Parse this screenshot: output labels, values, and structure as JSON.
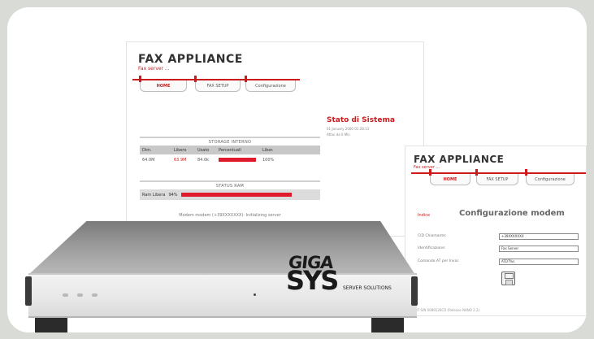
{
  "shot1": {
    "app_title": "FAX APPLIANCE",
    "app_subtitle": "Fax server ...",
    "tabs": [
      "HOME",
      "FAX SETUP",
      "Configurazione"
    ],
    "storage": {
      "heading": "STORAGE INTERNO",
      "columns": [
        "Dim.",
        "Libero",
        "Usato",
        "Percentuali",
        "Liber."
      ],
      "values": {
        "dim": "64.0M",
        "libero": "63.9M",
        "usato": "84.0k",
        "libero_pct": "100%"
      },
      "bar_fill": 0.99
    },
    "ram": {
      "heading": "STATUS RAM",
      "label": "Ram Libera",
      "pct": "94%",
      "bar_fill": 0.94
    },
    "modem_status": "Modem modem (+39XXXXXXX): Initializing server",
    "system": {
      "title": "Stato di Sistema",
      "date": "01 January 2000 01:28:13",
      "uptime": "Attivi da 0 Min"
    }
  },
  "shot2": {
    "app_title": "FAX APPLIANCE",
    "app_subtitle": "Fax server ...",
    "tabs": [
      "HOME",
      "FAX SETUP",
      "Configurazione"
    ],
    "index_link": "Indice",
    "title": "Configurazione modem",
    "fields": [
      {
        "label": "CID Chiamante:",
        "value": "+39XXXXXXX"
      },
      {
        "label": "Identificazione:",
        "value": "Fax Server"
      },
      {
        "label": "Comando AT per Invio:",
        "value": "ATDT%s"
      }
    ],
    "footer": "2007 S/N 0089126CD (Release NANO 2.2)"
  },
  "hardware": {
    "logo_top": "GIGA",
    "logo_bottom": "SYS",
    "tagline": "SERVER SOLUTIONS"
  },
  "colors": {
    "accent": "#cc1b1b",
    "bar": "#e11b2e",
    "background": "#d9dbd6"
  }
}
